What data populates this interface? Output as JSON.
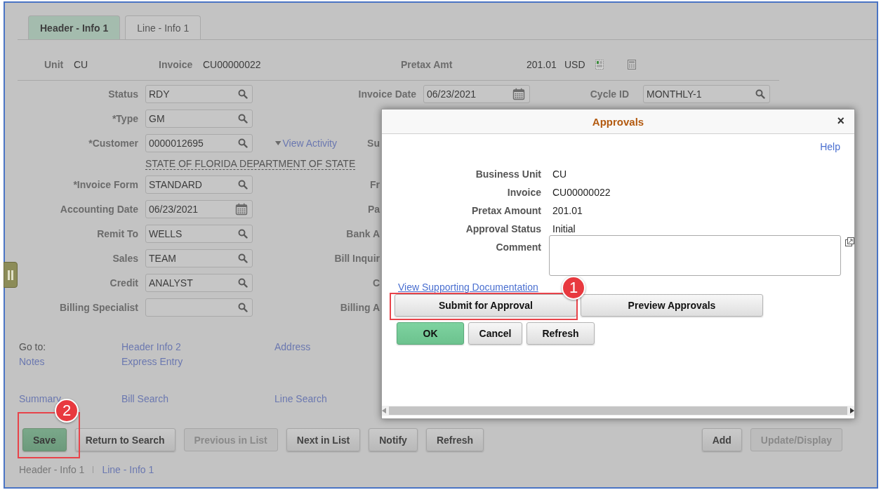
{
  "tabs": [
    {
      "label": "Header - Info 1",
      "selected": true
    },
    {
      "label": "Line - Info 1",
      "selected": false
    }
  ],
  "summary": [
    {
      "kind": "label",
      "text": "Unit"
    },
    {
      "kind": "value",
      "text": "CU"
    },
    {
      "kind": "label",
      "text": "Invoice"
    },
    {
      "kind": "value",
      "text": "CU00000022"
    },
    {
      "kind": "label",
      "text": "Pretax Amt"
    },
    {
      "kind": "value",
      "text": "201.01"
    },
    {
      "kind": "value",
      "text": "USD"
    }
  ],
  "form_rows": [
    {
      "label": "Status",
      "value": "RDY",
      "kind": "lookup",
      "middle": {
        "label": "Invoice Date",
        "value": "06/23/2021",
        "kind": "date"
      },
      "right": {
        "label": "Cycle ID",
        "value": "MONTHLY-1",
        "kind": "lookup"
      }
    },
    {
      "label": "*Type",
      "value": "GM",
      "kind": "lookup"
    },
    {
      "label": "*Customer",
      "value": "0000012695",
      "kind": "lookup",
      "link": "View Activity",
      "covered_label": "Su",
      "description": "STATE OF FLORIDA DEPARTMENT OF STATE"
    },
    {
      "label": "*Invoice Form",
      "value": "STANDARD",
      "kind": "lookup",
      "covered_label": "Fr"
    },
    {
      "label": "Accounting Date",
      "value": "06/23/2021",
      "kind": "date",
      "covered_label": "Pa"
    },
    {
      "label": "Remit To",
      "value": "WELLS",
      "kind": "lookup",
      "covered_label": "Bank A"
    },
    {
      "label": "Sales",
      "value": "TEAM",
      "kind": "lookup",
      "covered_label": "Bill Inquir"
    },
    {
      "label": "Credit",
      "value": "ANALYST",
      "kind": "lookup",
      "covered_label": "C"
    },
    {
      "label": "Billing Specialist",
      "kind": "lookup",
      "covered_label": "Billing A"
    }
  ],
  "goto": {
    "rows": [
      [
        "Go to:",
        "Header Info 2",
        "Address"
      ],
      [
        "Notes",
        "Express Entry"
      ],
      [
        "Summary",
        "Bill Search",
        "Line Search"
      ]
    ]
  },
  "buttons": [
    {
      "label": "Save",
      "kind": "primary",
      "disabled": false
    },
    {
      "label": "Return to Search",
      "kind": "normal",
      "disabled": false
    },
    {
      "label": "Previous in List",
      "kind": "normal",
      "disabled": true
    },
    {
      "label": "Next in List",
      "kind": "normal",
      "disabled": false
    },
    {
      "label": "Notify",
      "kind": "normal",
      "disabled": false
    },
    {
      "label": "Refresh",
      "kind": "normal",
      "disabled": false
    }
  ],
  "right_buttons": [
    {
      "label": "Add",
      "kind": "normal",
      "disabled": false
    },
    {
      "label": "Update/Display",
      "kind": "normal",
      "disabled": true
    }
  ],
  "breadcrumbs": [
    {
      "label": "Header - Info 1",
      "selected": true
    },
    {
      "label": "Line - Info 1",
      "selected": false
    }
  ],
  "dialog": {
    "title": "Approvals",
    "close": "×",
    "help": "Help",
    "fields": [
      {
        "label": "Business Unit",
        "value": "CU"
      },
      {
        "label": "Invoice",
        "value": "CU00000022"
      },
      {
        "label": "Pretax Amount",
        "value": "201.01"
      },
      {
        "label": "Approval Status",
        "value": "Initial"
      }
    ],
    "comment_label": "Comment",
    "link": "View Supporting Documentation",
    "action_buttons": [
      "Submit for Approval",
      "Preview Approvals"
    ],
    "buttons": [
      {
        "label": "OK",
        "kind": "primary"
      },
      {
        "label": "Cancel",
        "kind": "normal"
      },
      {
        "label": "Refresh",
        "kind": "normal"
      }
    ]
  },
  "callouts": [
    {
      "number": "1",
      "kind": "submit"
    },
    {
      "number": "2",
      "kind": "save"
    }
  ]
}
